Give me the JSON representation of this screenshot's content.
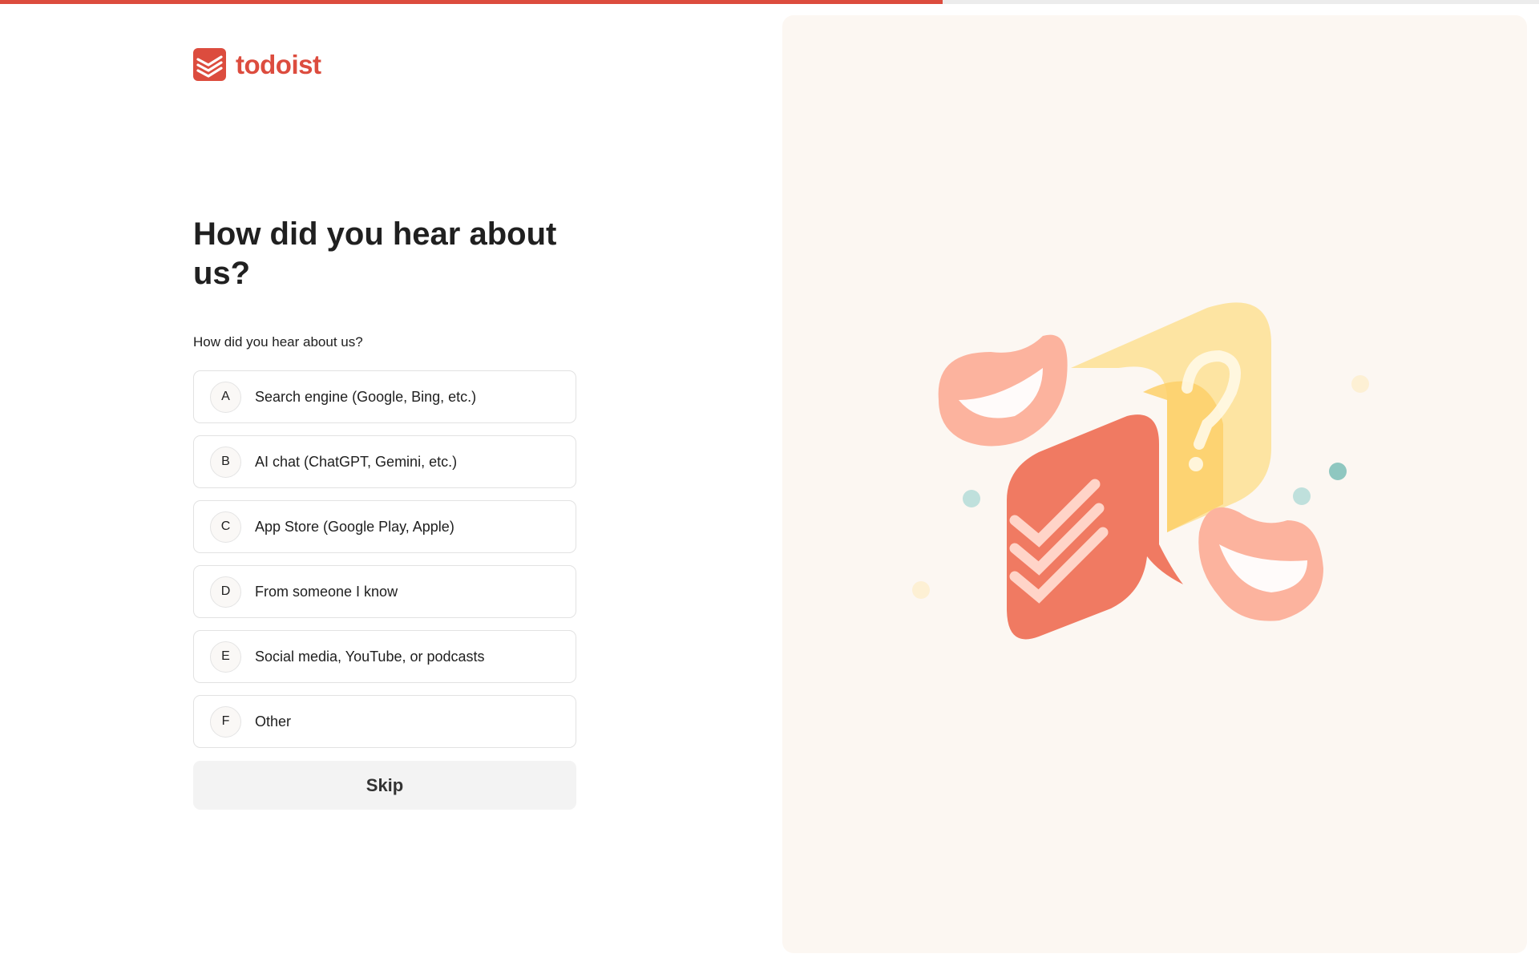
{
  "progress": {
    "percent": 61.25
  },
  "brand": {
    "name": "todoist",
    "color": "#dc4c3e"
  },
  "onboarding": {
    "heading": "How did you hear about us?",
    "question_label": "How did you hear about us?",
    "options": [
      {
        "key": "A",
        "label": "Search engine (Google, Bing, etc.)"
      },
      {
        "key": "B",
        "label": "AI chat (ChatGPT, Gemini, etc.)"
      },
      {
        "key": "C",
        "label": "App Store (Google Play, Apple)"
      },
      {
        "key": "D",
        "label": "From someone I know"
      },
      {
        "key": "E",
        "label": "Social media, YouTube, or podcasts"
      },
      {
        "key": "F",
        "label": "Other"
      }
    ],
    "skip_label": "Skip"
  },
  "illustration": {
    "icon": "conversation-question-illustration",
    "colors": {
      "red": "#f07a62",
      "yellow": "#fdd88a",
      "pink": "#fcb39e",
      "teal": "#8fc7c0",
      "panel": "#fcf7f2"
    }
  }
}
